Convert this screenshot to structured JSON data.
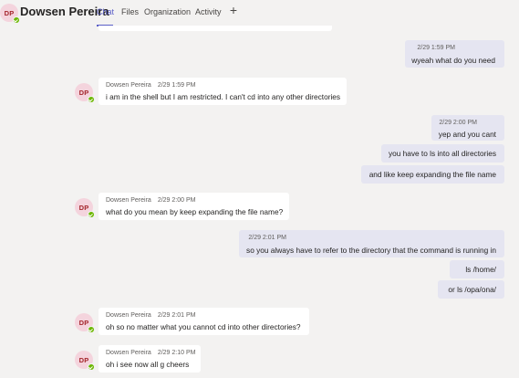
{
  "header": {
    "avatar_initials": "DP",
    "name": "Dowsen Pereira",
    "tabs": [
      "Chat",
      "Files",
      "Organization",
      "Activity"
    ],
    "add_tab_icon": "plus-icon"
  },
  "colors": {
    "accent": "#5b5fc7",
    "my_bubble": "#e5e5f1",
    "other_bubble": "#ffffff",
    "presence_available": "#6bb700",
    "background": "#f3f2f1"
  },
  "messages": [
    {
      "from": "me",
      "time": "2/29 1:59 PM",
      "text": "wyeah what do you need"
    },
    {
      "from": "other",
      "sender": "Dowsen Pereira",
      "avatar": "DP",
      "time": "2/29 1:59 PM",
      "text": "i am in the shell but I am restricted. I can't cd into any other directories"
    },
    {
      "from": "me",
      "time": "2/29 2:00 PM",
      "text": "yep and you cant"
    },
    {
      "from": "me",
      "text": "you have to ls into all directories"
    },
    {
      "from": "me",
      "text": "and like keep expanding the file name"
    },
    {
      "from": "other",
      "sender": "Dowsen Pereira",
      "avatar": "DP",
      "time": "2/29 2:00 PM",
      "text": "what do you mean by keep expanding the file name?"
    },
    {
      "from": "me",
      "time": "2/29 2:01 PM",
      "text": "so you always have to refer to the directory that the command is running in"
    },
    {
      "from": "me",
      "text": "ls /home/"
    },
    {
      "from": "me",
      "text": "or ls /opa/ona/"
    },
    {
      "from": "other",
      "sender": "Dowsen Pereira",
      "avatar": "DP",
      "time": "2/29 2:01 PM",
      "text": "oh so no matter what you cannot cd into other directories?"
    },
    {
      "from": "other",
      "sender": "Dowsen Pereira",
      "avatar": "DP",
      "time": "2/29 2:10 PM",
      "text": "oh i see now all g cheers"
    }
  ]
}
